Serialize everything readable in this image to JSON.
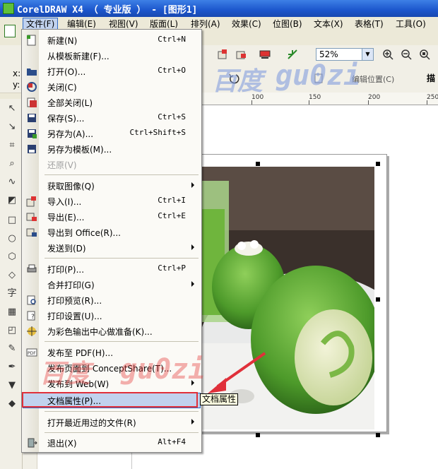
{
  "window": {
    "title": "CorelDRAW X4 （ 专业版 ） - [图形1]"
  },
  "menubar": [
    {
      "label": "文件(F)"
    },
    {
      "label": "编辑(E)"
    },
    {
      "label": "视图(V)"
    },
    {
      "label": "版面(L)"
    },
    {
      "label": "排列(A)"
    },
    {
      "label": "效果(C)"
    },
    {
      "label": "位图(B)"
    },
    {
      "label": "文本(X)"
    },
    {
      "label": "表格(T)"
    },
    {
      "label": "工具(O)"
    }
  ],
  "toolbar": {
    "zoom_value": "52%"
  },
  "property_bar": {
    "x_label": "x:",
    "y_label": "y:",
    "edit_label": "编辑位置(C)",
    "trailing_label": "描"
  },
  "ruler": {
    "ticks": [
      "100",
      "150",
      "200",
      "250"
    ]
  },
  "file_menu": {
    "items": [
      {
        "label": "新建(N)",
        "shortcut": "Ctrl+N"
      },
      {
        "label": "从模板新建(F)...",
        "shortcut": ""
      },
      {
        "label": "打开(O)...",
        "shortcut": "Ctrl+O"
      },
      {
        "label": "关闭(C)",
        "shortcut": ""
      },
      {
        "label": "全部关闭(L)",
        "shortcut": ""
      },
      {
        "label": "保存(S)...",
        "shortcut": "Ctrl+S"
      },
      {
        "label": "另存为(A)...",
        "shortcut": "Ctrl+Shift+S"
      },
      {
        "label": "另存为模板(M)...",
        "shortcut": ""
      },
      {
        "label": "还原(V)",
        "shortcut": ""
      },
      {
        "label": "获取图像(Q)",
        "shortcut": ""
      },
      {
        "label": "导入(I)...",
        "shortcut": "Ctrl+I"
      },
      {
        "label": "导出(E)...",
        "shortcut": "Ctrl+E"
      },
      {
        "label": "导出到 Office(R)...",
        "shortcut": ""
      },
      {
        "label": "发送到(D)",
        "shortcut": ""
      },
      {
        "label": "打印(P)...",
        "shortcut": "Ctrl+P"
      },
      {
        "label": "合并打印(G)",
        "shortcut": ""
      },
      {
        "label": "打印预览(R)...",
        "shortcut": ""
      },
      {
        "label": "打印设置(U)...",
        "shortcut": ""
      },
      {
        "label": "为彩色输出中心做准备(K)...",
        "shortcut": ""
      },
      {
        "label": "发布至 PDF(H)...",
        "shortcut": ""
      },
      {
        "label": "发布页面到 ConceptShare(T)...",
        "shortcut": ""
      },
      {
        "label": "发布到 Web(W)",
        "shortcut": ""
      },
      {
        "label": "文档属性(P)...",
        "shortcut": ""
      },
      {
        "label": "打开最近用过的文件(R)",
        "shortcut": ""
      },
      {
        "label": "退出(X)",
        "shortcut": "Alt+F4"
      }
    ]
  },
  "tooltip": {
    "text": "文档属性"
  },
  "toolbox": {
    "text_tool_glyph": "字"
  },
  "watermarks": {
    "top_a": "百度",
    "top_b": "gu0zi",
    "bottom_a": "百度",
    "bottom_b": "gu0zi"
  },
  "colors": {
    "highlight_border": "#316ac5",
    "highlight_fill": "#c1d2ee",
    "annotation_red": "#e0303a"
  }
}
